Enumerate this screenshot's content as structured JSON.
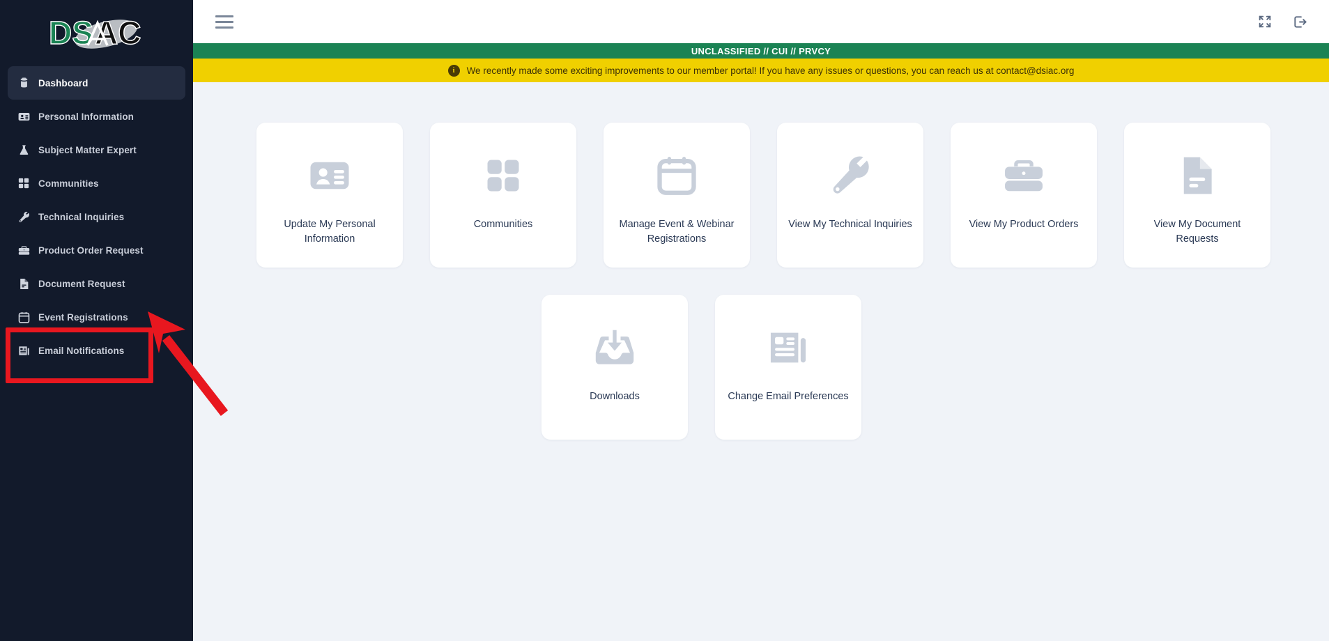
{
  "brand": {
    "logo_text": "DSIAC",
    "logo_colors": {
      "primary": "#1b8354",
      "secondary": "#b9bdc2",
      "dark": "#111111"
    }
  },
  "colors": {
    "sidebar_bg": "#121a2b",
    "sidebar_active_bg": "#232c40",
    "page_bg": "#f0f3f8",
    "classification_green": "#1b8354",
    "notice_yellow": "#f0d000",
    "annotation_red": "#e8171f",
    "card_bg": "#ffffff",
    "icon_gray": "#c8cfda",
    "text_dark": "#2b3a55"
  },
  "topbar": {
    "menu_icon": "hamburger-menu-icon",
    "fullscreen_icon": "fullscreen-expand-icon",
    "logout_icon": "logout-icon"
  },
  "classification": {
    "text": "UNCLASSIFIED // CUI // PRVCY"
  },
  "notice": {
    "icon": "info-icon",
    "text": "We recently made some exciting improvements to our member portal! If you have any issues or questions, you can reach us at contact@dsiac.org"
  },
  "sidebar": {
    "items": [
      {
        "label": "Dashboard",
        "icon": "dashboard-icon",
        "active": true
      },
      {
        "label": "Personal Information",
        "icon": "id-card-icon",
        "active": false
      },
      {
        "label": "Subject Matter Expert",
        "icon": "flask-icon",
        "active": false
      },
      {
        "label": "Communities",
        "icon": "grid-squares-icon",
        "active": false
      },
      {
        "label": "Technical Inquiries",
        "icon": "wrench-icon",
        "active": false
      },
      {
        "label": "Product Order Request",
        "icon": "briefcase-icon",
        "active": false
      },
      {
        "label": "Document Request",
        "icon": "document-icon",
        "active": false
      },
      {
        "label": "Event Registrations",
        "icon": "calendar-icon",
        "active": false
      },
      {
        "label": "Email Notifications",
        "icon": "newsletter-icon",
        "active": false
      }
    ]
  },
  "main": {
    "row1": [
      {
        "label": "Update My Personal Information",
        "icon": "id-card-icon"
      },
      {
        "label": "Communities",
        "icon": "grid-squares-icon"
      },
      {
        "label": "Manage Event & Webinar Registrations",
        "icon": "calendar-icon"
      },
      {
        "label": "View My Technical Inquiries",
        "icon": "wrench-icon"
      },
      {
        "label": "View My Product Orders",
        "icon": "briefcase-icon"
      },
      {
        "label": "View My Document Requests",
        "icon": "document-icon"
      }
    ],
    "row2": [
      {
        "label": "Downloads",
        "icon": "inbox-download-icon"
      },
      {
        "label": "Change Email Preferences",
        "icon": "newsletter-icon"
      }
    ]
  },
  "annotation": {
    "box_target": "Email Notifications",
    "arrow": "pointer-arrow"
  }
}
